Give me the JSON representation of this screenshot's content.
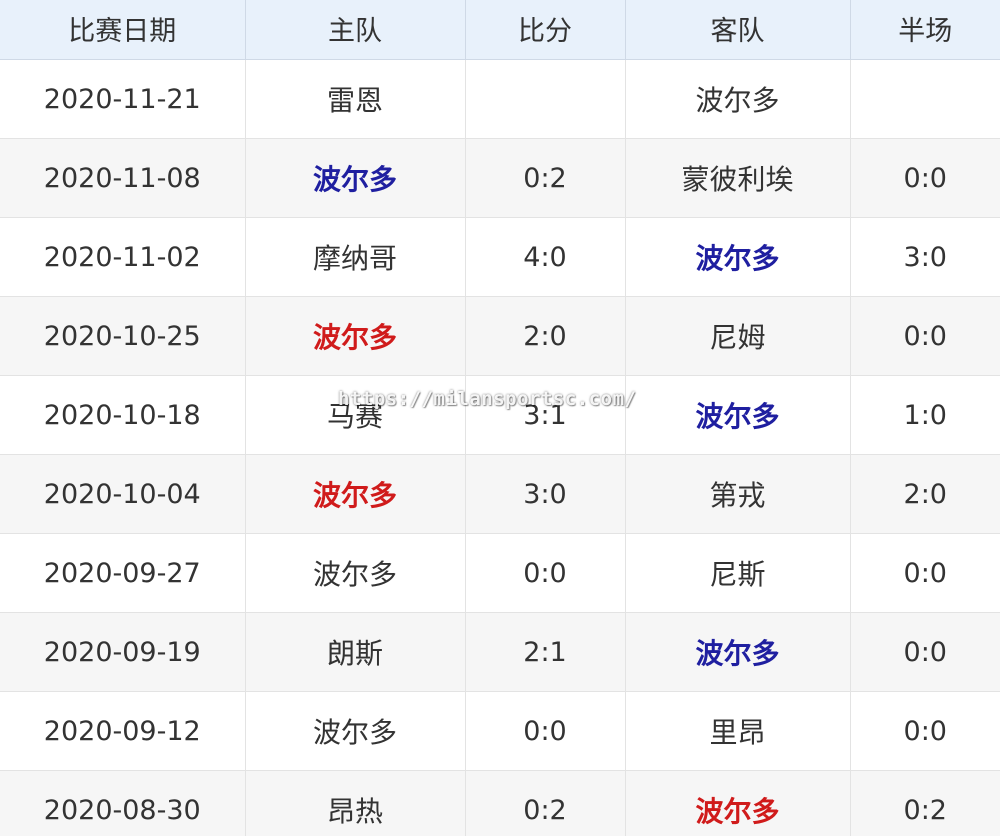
{
  "table": {
    "headers": {
      "date": "比赛日期",
      "home": "主队",
      "score": "比分",
      "away": "客队",
      "half": "半场"
    },
    "colors": {
      "highlight_blue": "#1f1fa0",
      "highlight_red": "#d01b1b",
      "header_bg": "#e8f1fb",
      "alt_row_bg": "#f6f6f6"
    },
    "rows": [
      {
        "date": "2020-11-21",
        "home": "雷恩",
        "score": "",
        "away": "波尔多",
        "half": ""
      },
      {
        "date": "2020-11-08",
        "home": "波尔多",
        "score": "0:2",
        "away": "蒙彼利埃",
        "half": "0:0"
      },
      {
        "date": "2020-11-02",
        "home": "摩纳哥",
        "score": "4:0",
        "away": "波尔多",
        "half": "3:0"
      },
      {
        "date": "2020-10-25",
        "home": "波尔多",
        "score": "2:0",
        "away": "尼姆",
        "half": "0:0"
      },
      {
        "date": "2020-10-18",
        "home": "马赛",
        "score": "3:1",
        "away": "波尔多",
        "half": "1:0"
      },
      {
        "date": "2020-10-04",
        "home": "波尔多",
        "score": "3:0",
        "away": "第戎",
        "half": "2:0"
      },
      {
        "date": "2020-09-27",
        "home": "波尔多",
        "score": "0:0",
        "away": "尼斯",
        "half": "0:0"
      },
      {
        "date": "2020-09-19",
        "home": "朗斯",
        "score": "2:1",
        "away": "波尔多",
        "half": "0:0"
      },
      {
        "date": "2020-09-12",
        "home": "波尔多",
        "score": "0:0",
        "away": "里昂",
        "half": "0:0"
      },
      {
        "date": "2020-08-30",
        "home": "昂热",
        "score": "0:2",
        "away": "波尔多",
        "half": "0:2"
      }
    ]
  },
  "watermark": {
    "text": "https://milansportsc.com/"
  }
}
